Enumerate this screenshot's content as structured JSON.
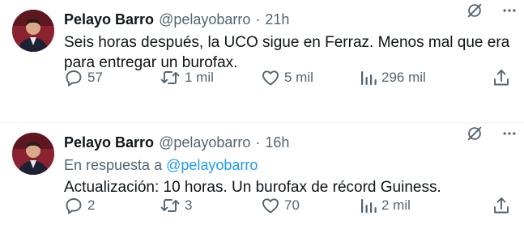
{
  "tweets": [
    {
      "author_name": "Pelayo Barro",
      "handle": "@pelayobarro",
      "separator": "·",
      "time": "21h",
      "text": "Seis horas después, la UCO sigue en Ferraz. Menos mal que era para entregar un burofax.",
      "replies": "57",
      "reposts": "1 mil",
      "likes": "5 mil",
      "views": "296 mil"
    },
    {
      "author_name": "Pelayo Barro",
      "handle": "@pelayobarro",
      "separator": "·",
      "time": "16h",
      "reply_to_prefix": "En respuesta a",
      "reply_to_handle": "@pelayobarro",
      "text": "Actualización: 10 horas. Un burofax de récord Guiness.",
      "replies": "2",
      "reposts": "3",
      "likes": "70",
      "views": "2 mil"
    }
  ],
  "icons": {
    "grok": "grok-icon",
    "more": "more-icon",
    "reply": "reply-icon",
    "repost": "repost-icon",
    "like": "like-icon",
    "views": "views-icon",
    "share": "share-icon"
  },
  "colors": {
    "text": "#0f1419",
    "secondary": "#536471",
    "link": "#1d9bf0",
    "divider": "#eff3f4"
  }
}
